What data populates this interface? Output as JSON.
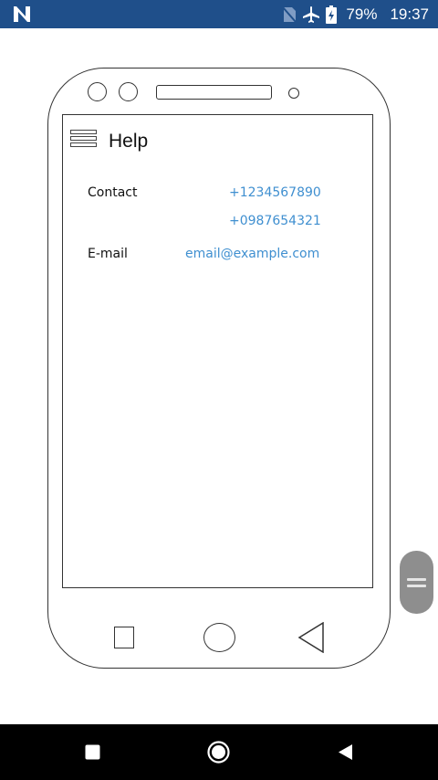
{
  "status_bar": {
    "battery_percent": "79%",
    "time": "19:37",
    "icons": [
      "n-logo-icon",
      "no-sim-icon",
      "airplane-mode-icon",
      "battery-charging-icon"
    ],
    "background_color": "#1f4f8a"
  },
  "app": {
    "title": "Help",
    "menu_icon": "hamburger-menu-icon"
  },
  "contact": {
    "label": "Contact",
    "phones": [
      "+1234567890",
      "+0987654321"
    ]
  },
  "email": {
    "label": "E-mail",
    "address": "email@example.com"
  },
  "colors": {
    "link": "#3f8fd0",
    "frame_stroke": "#333333",
    "system_nav_bar": "#000000"
  },
  "mock_nav_icons": [
    "recent-apps-square-icon",
    "home-circle-icon",
    "back-triangle-icon"
  ],
  "system_nav_icons": [
    "recent-apps-icon",
    "home-icon",
    "back-icon"
  ],
  "side_handle_icon": "drag-handle-icon"
}
